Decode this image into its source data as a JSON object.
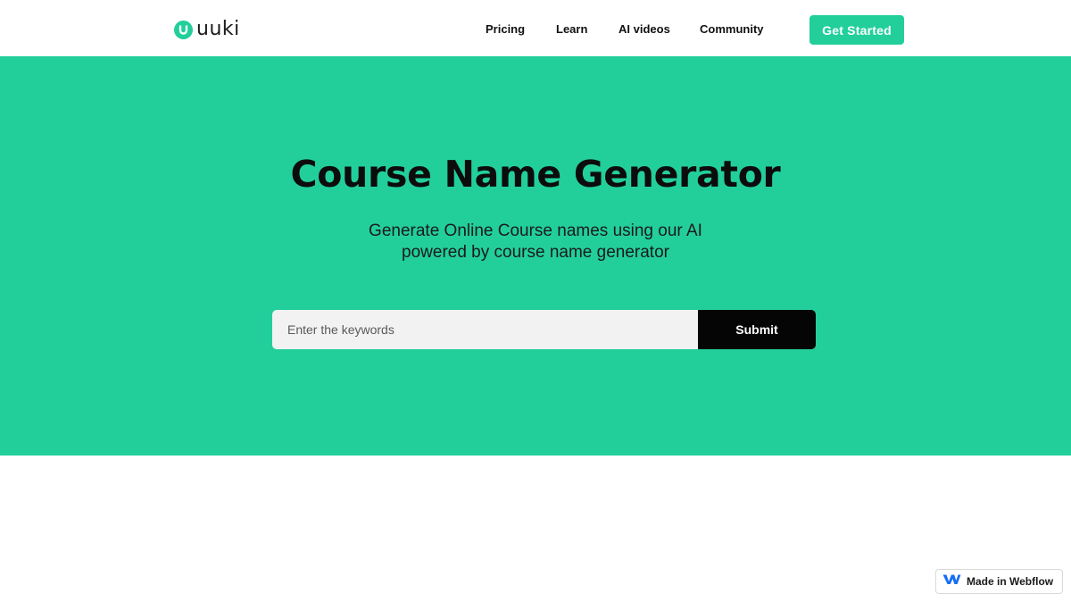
{
  "brand": {
    "name": "uuki",
    "accent_color": "#22cf9b"
  },
  "nav": {
    "links": [
      {
        "label": "Pricing"
      },
      {
        "label": "Learn"
      },
      {
        "label": "AI videos"
      },
      {
        "label": "Community"
      }
    ],
    "cta_label": "Get Started"
  },
  "hero": {
    "title": "Course Name Generator",
    "subtitle": "Generate Online Course names using our AI powered by course name generator",
    "input_placeholder": "Enter the keywords",
    "input_value": "",
    "submit_label": "Submit"
  },
  "footer_badge": {
    "label": "Made in Webflow",
    "icon": "webflow-logo-icon"
  }
}
